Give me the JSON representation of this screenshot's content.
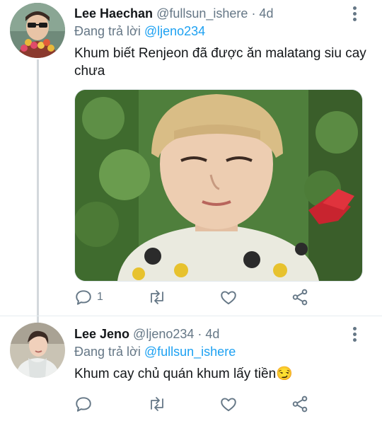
{
  "colors": {
    "accent": "#1da1f2",
    "muted": "#657786",
    "text": "#14171a"
  },
  "tweets": [
    {
      "name": "Lee Haechan",
      "handle": "@fullsun_ishere",
      "time": "· 4d",
      "reply_prefix": "Đang trả lời",
      "reply_to": "@ljeno234",
      "text": "Khum biết Renjeon đã được ăn malatang siu cay chưa",
      "has_media": true,
      "actions": {
        "reply_count": "1",
        "retweet_count": "",
        "like_count": ""
      }
    },
    {
      "name": "Lee Jeno",
      "handle": "@ljeno234",
      "time": "· 4d",
      "reply_prefix": "Đang trả lời",
      "reply_to": "@fullsun_ishere",
      "text": "Khum cay chủ quán khum lấy tiền",
      "emoji": "😏",
      "has_media": false,
      "actions": {
        "reply_count": "",
        "retweet_count": "",
        "like_count": ""
      }
    }
  ],
  "icons": [
    "reply-icon",
    "retweet-icon",
    "like-icon",
    "share-icon",
    "more-icon"
  ]
}
